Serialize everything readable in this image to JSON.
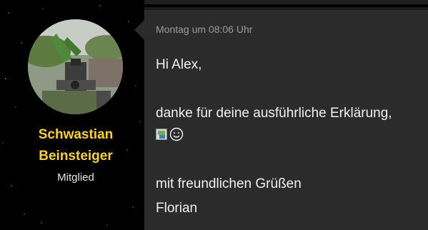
{
  "author": {
    "name_line1": "Schwastian",
    "name_line2": "Beinsteiger",
    "role": "Mitglied"
  },
  "post": {
    "timestamp": "Montag um 08:06 Uhr",
    "lines": [
      "Hi Alex,",
      "danke für deine ausführliche Erklärung,",
      "mit freundlichen Grüßen",
      "Florian"
    ]
  },
  "icons": {
    "avatar": "avatar-photo",
    "broken_image": "broken-image-icon",
    "smiley": "smiley-icon"
  },
  "colors": {
    "page_background": "#000000",
    "message_background": "#2b2b2b",
    "author_name": "#ffd21e",
    "text": "#f0f0f0",
    "timestamp": "#9a9a9a"
  }
}
